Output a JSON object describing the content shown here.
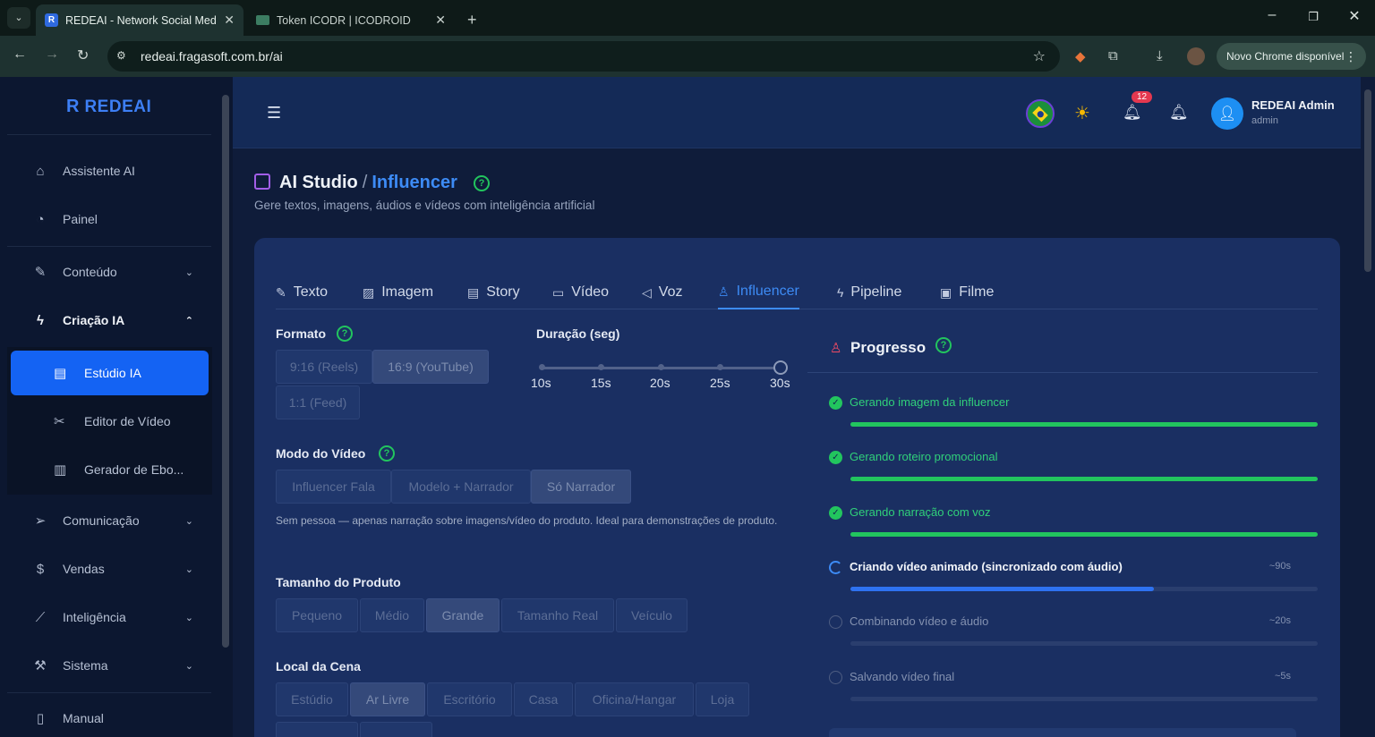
{
  "browser": {
    "tabs": [
      {
        "title": "REDEAI - Network Social Media",
        "favicon": "R"
      },
      {
        "title": "Token ICODR | ICODROID"
      }
    ],
    "url": "redeai.fragasoft.com.br/ai",
    "new_chrome": "Novo Chrome disponível"
  },
  "sidebar": {
    "logo": "REDEAI",
    "items": [
      {
        "label": "Assistente AI",
        "icon": "home-icon"
      },
      {
        "label": "Painel",
        "icon": "gauge-icon"
      },
      {
        "label": "Conteúdo",
        "icon": "pen-icon"
      },
      {
        "label": "Criação IA",
        "icon": "bolt-icon"
      },
      {
        "label": "Comunicação",
        "icon": "send-icon"
      },
      {
        "label": "Vendas",
        "icon": "dollar-icon"
      },
      {
        "label": "Inteligência",
        "icon": "chart-icon"
      },
      {
        "label": "Sistema",
        "icon": "wrench-icon"
      },
      {
        "label": "Manual",
        "icon": "book-icon"
      }
    ],
    "submenu": [
      {
        "label": "Estúdio IA",
        "icon": "studio-icon"
      },
      {
        "label": "Editor de Vídeo",
        "icon": "scissors-icon"
      },
      {
        "label": "Gerador de Ebo...",
        "icon": "ebook-icon"
      }
    ]
  },
  "header": {
    "notifications": "12",
    "user_name": "REDEAI Admin",
    "user_role": "admin"
  },
  "page": {
    "title": "AI Studio",
    "title_accent": "Influencer",
    "subtitle": "Gere textos, imagens, áudios e vídeos com inteligência artificial"
  },
  "tabs": [
    {
      "label": "Texto",
      "icon": "pen-icon"
    },
    {
      "label": "Imagem",
      "icon": "image-icon"
    },
    {
      "label": "Story",
      "icon": "doc-icon"
    },
    {
      "label": "Vídeo",
      "icon": "video-icon"
    },
    {
      "label": "Voz",
      "icon": "speaker-icon"
    },
    {
      "label": "Influencer",
      "icon": "user-icon"
    },
    {
      "label": "Pipeline",
      "icon": "bolt-icon"
    },
    {
      "label": "Filme",
      "icon": "film-icon"
    }
  ],
  "form": {
    "format_label": "Formato",
    "format_options": [
      "9:16 (Reels)",
      "16:9 (YouTube)",
      "1:1 (Feed)"
    ],
    "format_selected": "16:9 (YouTube)",
    "duration_label": "Duração (seg)",
    "duration_ticks": [
      "10s",
      "15s",
      "20s",
      "25s",
      "30s"
    ],
    "duration_value": "30s",
    "mode_label": "Modo do Vídeo",
    "mode_options": [
      "Influencer Fala",
      "Modelo + Narrador",
      "Só Narrador"
    ],
    "mode_selected": "Só Narrador",
    "mode_desc": "Sem pessoa — apenas narração sobre imagens/vídeo do produto. Ideal para demonstrações de produto.",
    "size_label": "Tamanho do Produto",
    "size_options": [
      "Pequeno",
      "Médio",
      "Grande",
      "Tamanho Real",
      "Veículo"
    ],
    "size_selected": "Grande",
    "scene_label": "Local da Cena",
    "scene_options": [
      "Estúdio",
      "Ar Livre",
      "Escritório",
      "Casa",
      "Oficina/Hangar",
      "Loja"
    ],
    "scene_selected": "Ar Livre"
  },
  "progress": {
    "title": "Progresso",
    "steps": [
      {
        "label": "Gerando imagem da influencer",
        "status": "done",
        "time": "",
        "progress": 1.0
      },
      {
        "label": "Gerando roteiro promocional",
        "status": "done",
        "time": "",
        "progress": 1.0
      },
      {
        "label": "Gerando narração com voz",
        "status": "done",
        "time": "",
        "progress": 1.0
      },
      {
        "label": "Criando vídeo animado (sincronizado com áudio)",
        "status": "running",
        "time": "~90s",
        "progress": 0.65
      },
      {
        "label": "Combinando vídeo e áudio",
        "status": "waiting",
        "time": "~20s",
        "progress": 0
      },
      {
        "label": "Salvando vídeo final",
        "status": "waiting",
        "time": "~5s",
        "progress": 0
      }
    ]
  }
}
